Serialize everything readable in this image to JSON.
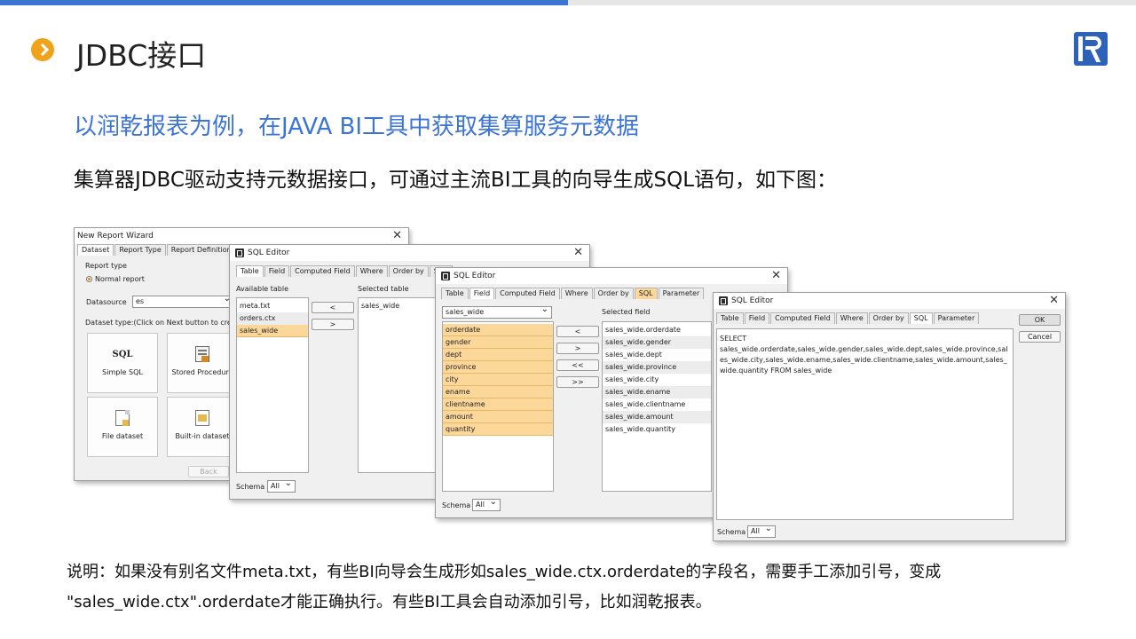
{
  "slide": {
    "title": "JDBC接口",
    "subtitle": "以润乾报表为例，在JAVA BI工具中获取集算服务元数据",
    "description": "集算器JDBC驱动支持元数据接口，可通过主流BI工具的向导生成SQL语句，如下图：",
    "note_line1": "说明：如果没有别名文件meta.txt，有些BI向导会生成形如sales_wide.ctx.orderdate的字段名，需要手工添加引号，变成",
    "note_line2": "\"sales_wide.ctx\".orderdate才能正确执行。有些BI工具会自动添加引号，比如润乾报表。",
    "accent_color": "#3b74d6",
    "bullet_color": "#f0a31a"
  },
  "wizard": {
    "title": "New Report Wizard",
    "tabs": [
      "Dataset",
      "Report Type",
      "Report Definition"
    ],
    "report_type_label": "Report type",
    "normal_report": "Normal report",
    "datasource_label": "Datasource",
    "datasource_value": "es",
    "hint": "Dataset type:(Click on Next button to create data",
    "buttons": [
      {
        "label": "Simple SQL",
        "icon_text": "SQL",
        "icon": "sql-icon"
      },
      {
        "label": "Stored Procedure",
        "icon": "procedure-icon"
      },
      {
        "label": "File dataset",
        "icon": "file-icon"
      },
      {
        "label": "Built-in dataset",
        "icon": "builtin-icon"
      }
    ],
    "back": "Back"
  },
  "editor1": {
    "title": "SQL Editor",
    "tabs": [
      "Table",
      "Field",
      "Computed Field",
      "Where",
      "Order by",
      "SQL"
    ],
    "available_label": "Available table",
    "selected_label": "Selected table",
    "available": [
      "meta.txt",
      "orders.ctx",
      "sales_wide"
    ],
    "selected": [
      "sales_wide"
    ],
    "btn_left": "<",
    "btn_right": ">",
    "schema_label": "Schema",
    "schema_value": "All"
  },
  "editor2": {
    "title": "SQL Editor",
    "tabs": [
      "Table",
      "Field",
      "Computed Field",
      "Where",
      "Order by",
      "SQL",
      "Parameter"
    ],
    "table_select": "sales_wide",
    "selected_label": "Selected field",
    "fields": [
      "orderdate",
      "gender",
      "dept",
      "province",
      "city",
      "ename",
      "clientname",
      "amount",
      "quantity"
    ],
    "selected": [
      "sales_wide.orderdate",
      "sales_wide.gender",
      "sales_wide.dept",
      "sales_wide.province",
      "sales_wide.city",
      "sales_wide.ename",
      "sales_wide.clientname",
      "sales_wide.amount",
      "sales_wide.quantity"
    ],
    "btns": [
      "<",
      ">",
      "<<",
      ">>"
    ],
    "schema_label": "Schema",
    "schema_value": "All"
  },
  "editor3": {
    "title": "SQL Editor",
    "tabs": [
      "Table",
      "Field",
      "Computed Field",
      "Where",
      "Order by",
      "SQL",
      "Parameter"
    ],
    "sql_line1": "SELECT",
    "sql_body": "sales_wide.orderdate,sales_wide.gender,sales_wide.dept,sales_wide.province,sales_wide.city,sales_wide.ename,sales_wide.clientname,sales_wide.amount,sales_wide.quantity FROM sales_wide",
    "ok": "OK",
    "cancel": "Cancel",
    "schema_label": "Schema",
    "schema_value": "All"
  }
}
